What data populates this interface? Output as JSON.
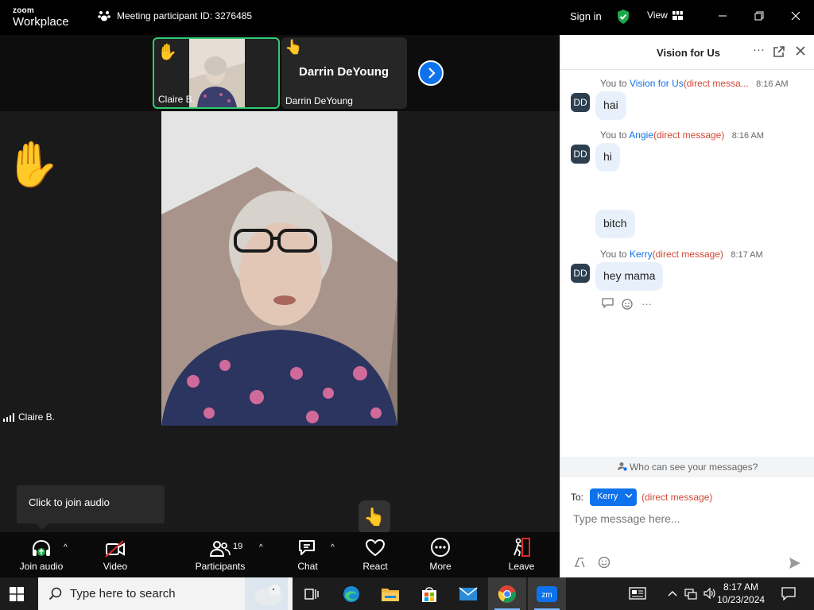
{
  "titlebar": {
    "logo_top": "zoom",
    "logo_bottom": "Workplace",
    "meeting_id": "Meeting participant ID: 3276485",
    "sign_in": "Sign in",
    "view": "View"
  },
  "strip": {
    "tiles": [
      {
        "name": "Claire B."
      },
      {
        "name": "Darrin DeYoung",
        "big_name": "Darrin DeYoung"
      }
    ]
  },
  "main_video": {
    "speaker_name": "Claire B."
  },
  "tooltip": {
    "text": "Click to join audio"
  },
  "toolbar": {
    "join_audio": "Join audio",
    "video": "Video",
    "participants": "Participants",
    "participants_count": "19",
    "chat": "Chat",
    "react": "React",
    "more": "More",
    "leave": "Leave"
  },
  "chat": {
    "title": "Vision for Us",
    "messages": [
      {
        "prefix": "You to",
        "to": "Vision for Us",
        "dm": "(direct messa...",
        "time": "8:16 AM",
        "avatar": "DD",
        "texts": [
          "hai"
        ]
      },
      {
        "prefix": "You to",
        "to": "Angie",
        "dm": "(direct message)",
        "time": "8:16 AM",
        "avatar": "DD",
        "texts": [
          "hi",
          "bitch"
        ]
      },
      {
        "prefix": "You to",
        "to": "Kerry",
        "dm": "(direct message)",
        "time": "8:17 AM",
        "avatar": "DD",
        "texts": [
          "hey mama"
        ]
      }
    ],
    "who_can_see": "Who can see your messages?",
    "to_label": "To:",
    "to_recipient": "Kerry",
    "to_dm": "(direct message)",
    "input_placeholder": "Type message here..."
  },
  "taskbar": {
    "search_placeholder": "Type here to search",
    "time": "8:17 AM",
    "date": "10/23/2024"
  },
  "colors": {
    "accent": "#0e72ed",
    "green_border": "#2ecc71",
    "dm_red": "#d14836"
  }
}
